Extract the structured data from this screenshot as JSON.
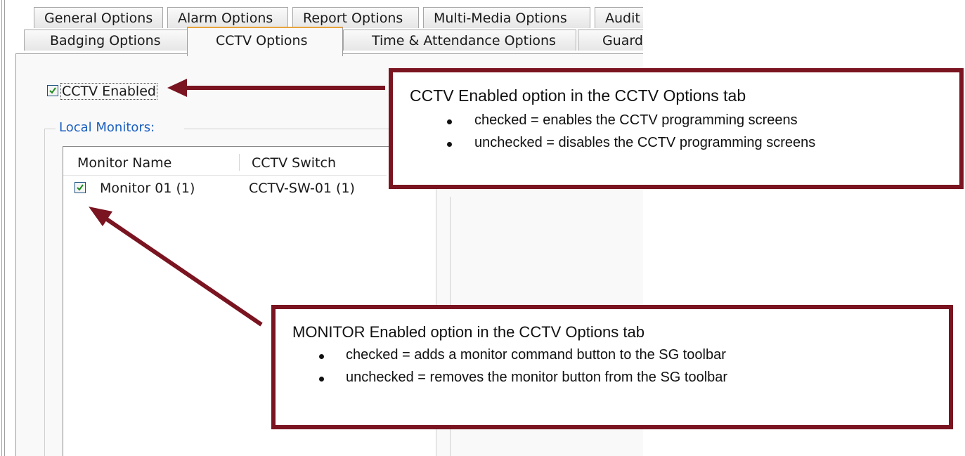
{
  "tabs_row1": [
    {
      "label": "General Options"
    },
    {
      "label": "Alarm Options"
    },
    {
      "label": "Report Options"
    },
    {
      "label": "Multi-Media Options"
    },
    {
      "label": "Audit"
    }
  ],
  "tabs_row2": [
    {
      "label": "Badging Options"
    },
    {
      "label": "CCTV Options",
      "active": true
    },
    {
      "label": "Time & Attendance Options"
    },
    {
      "label": "Guard"
    }
  ],
  "cctv_enabled": {
    "label": "CCTV Enabled",
    "checked": true
  },
  "local_monitors": {
    "group_label": "Local Monitors:",
    "columns": [
      "Monitor Name",
      "CCTV Switch"
    ],
    "rows": [
      {
        "checked": true,
        "name": "Monitor 01 (1)",
        "switch": "CCTV-SW-01 (1)"
      }
    ]
  },
  "callouts": [
    {
      "title": "CCTV Enabled option in the CCTV Options tab",
      "bullets": [
        "checked = enables the CCTV programming screens",
        "unchecked = disables the CCTV programming screens"
      ]
    },
    {
      "title": "MONITOR Enabled option in the CCTV Options tab",
      "bullets": [
        "checked = adds a monitor command button to the SG toolbar",
        "unchecked = removes the monitor button from the SG toolbar"
      ]
    }
  ],
  "colors": {
    "callout_border": "#7a1420",
    "active_tab_accent": "#e8a33a",
    "checkbox_check": "#1e8a1e"
  }
}
